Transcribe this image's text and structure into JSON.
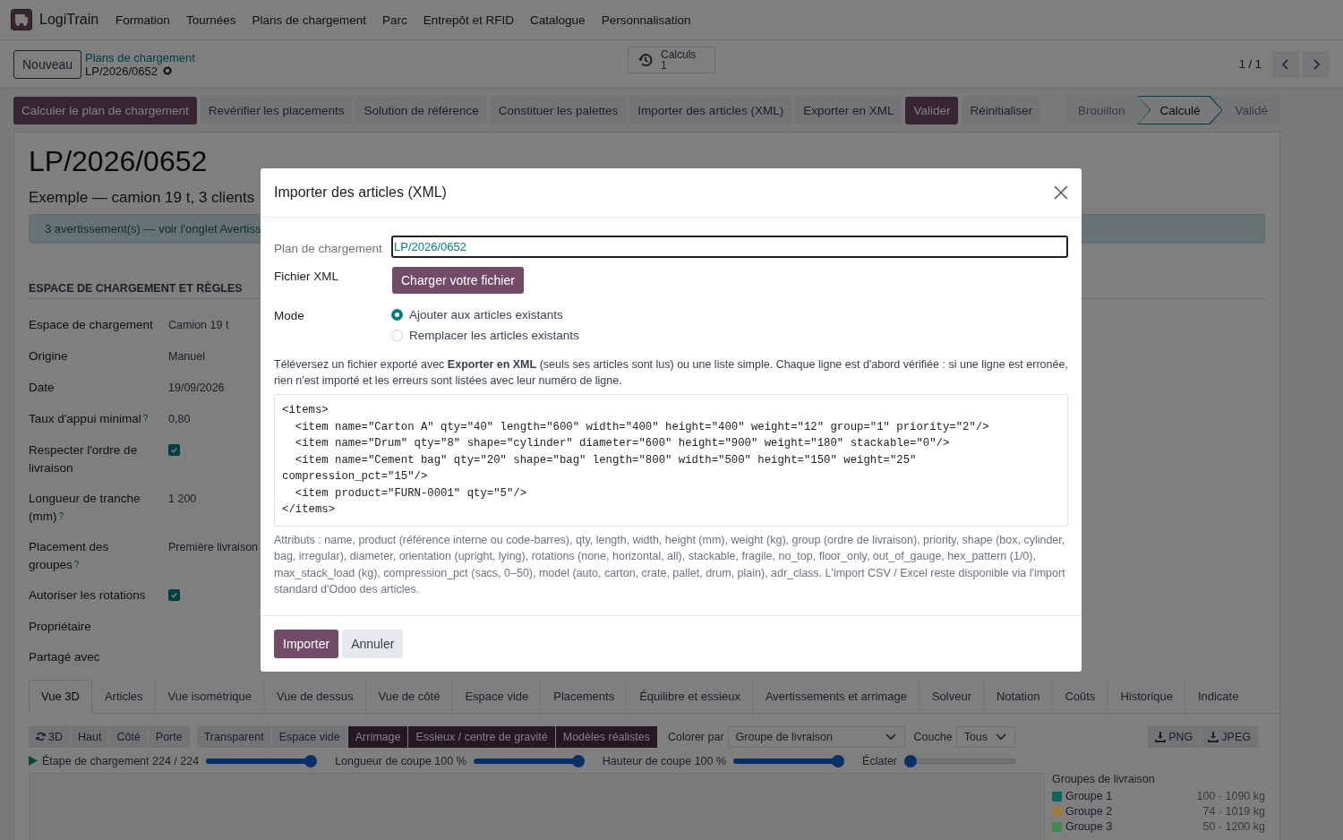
{
  "navbar": {
    "app_name": "LogiTrain",
    "menu": [
      "Formation",
      "Tournées",
      "Plans de chargement",
      "Parc",
      "Entrepôt et RFID",
      "Catalogue",
      "Personnalisation"
    ]
  },
  "control_panel": {
    "new_button": "Nouveau",
    "breadcrumb": "Plans de chargement",
    "record": "LP/2026/0652",
    "stat_button": {
      "label": "Calculs",
      "value": "1"
    },
    "pager": "1 / 1"
  },
  "action_buttons": [
    {
      "label": "Calculer le plan de chargement",
      "primary": true
    },
    {
      "label": "Revérifier les placements",
      "primary": false
    },
    {
      "label": "Solution de référence",
      "primary": false
    },
    {
      "label": "Constituer les palettes",
      "primary": false
    },
    {
      "label": "Importer des articles (XML)",
      "primary": false
    },
    {
      "label": "Exporter en XML",
      "primary": false
    },
    {
      "label": "Valider",
      "primary": true
    },
    {
      "label": "Réinitialiser",
      "primary": false
    }
  ],
  "status_steps": [
    {
      "label": "Brouillon",
      "selected": false
    },
    {
      "label": "Calculé",
      "selected": true
    },
    {
      "label": "Validé",
      "selected": false
    }
  ],
  "sheet": {
    "title": "LP/2026/0652",
    "subtitle": "Exemple — camion 19 t, 3 clients",
    "alert": "3 avertissement(s) — voir l'onglet Avertiss",
    "section": "ESPACE DE CHARGEMENT ET RÈGLES",
    "fields": [
      {
        "label": "Espace de chargement",
        "kind": "text",
        "value": "Camion 19 t"
      },
      {
        "label": "Origine",
        "kind": "text",
        "value": "Manuel"
      },
      {
        "label": "Date",
        "kind": "text",
        "value": "19/09/2026"
      },
      {
        "label": "Taux d'appui minimal",
        "help": "?",
        "kind": "text",
        "value": "0,80"
      },
      {
        "label": "Respecter l'ordre de livraison",
        "kind": "checkbox",
        "checked": true
      },
      {
        "label": "Longueur de tranche (mm)",
        "help": "?",
        "kind": "text",
        "value": "1 200"
      },
      {
        "label": "Placement des groupes",
        "help": "?",
        "kind": "text",
        "value": "Première livraison"
      },
      {
        "label": "Autoriser les rotations",
        "kind": "checkbox",
        "checked": true
      },
      {
        "label": "Propriétaire",
        "kind": "empty"
      },
      {
        "label": "Partagé avec",
        "kind": "empty"
      }
    ]
  },
  "notebook": {
    "tabs": [
      {
        "label": "Vue 3D",
        "selected": true
      },
      {
        "label": "Articles",
        "selected": false
      },
      {
        "label": "Vue isométrique",
        "selected": false
      },
      {
        "label": "Vue de dessus",
        "selected": false
      },
      {
        "label": "Vue de côté",
        "selected": false
      },
      {
        "label": "Espace vide",
        "selected": false
      },
      {
        "label": "Placements",
        "selected": false
      },
      {
        "label": "Équilibre et essieux",
        "selected": false
      },
      {
        "label": "Avertissements et arrimage",
        "selected": false
      },
      {
        "label": "Solveur",
        "selected": false
      },
      {
        "label": "Notation",
        "selected": false
      },
      {
        "label": "Coûts",
        "selected": false
      },
      {
        "label": "Historique",
        "selected": false
      },
      {
        "label": "Indicate",
        "selected": false
      }
    ]
  },
  "viewer": {
    "view_buttons": [
      "3D",
      "Haut",
      "Côté",
      "Porte"
    ],
    "toggles": [
      {
        "label": "Transparent",
        "on": false
      },
      {
        "label": "Espace vide",
        "on": false
      },
      {
        "label": "Arrimage",
        "on": true
      },
      {
        "label": "Essieux / centre de gravité",
        "on": true
      },
      {
        "label": "Modèles réalistes",
        "on": true
      }
    ],
    "color_by": {
      "label": "Colorer par",
      "value": "Groupe de livraison"
    },
    "layer": {
      "label": "Couche",
      "value": "Tous"
    },
    "exports": [
      "PNG",
      "JPEG"
    ],
    "sliders": [
      {
        "label": "Étape de chargement 224 / 224",
        "level": 1
      },
      {
        "label": "Longueur de coupe 100 %",
        "level": 1
      },
      {
        "label": "Hauteur de coupe 100 %",
        "level": 1
      },
      {
        "label": "Éclater",
        "level": 0
      }
    ],
    "legend": {
      "title": "Groupes de livraison",
      "items": [
        {
          "name": "Groupe 1",
          "stats": "100 · 1090 kg",
          "color": "#0e6560"
        },
        {
          "name": "Groupe 2",
          "stats": "74 · 1019 kg",
          "color": "#9e7a3c"
        },
        {
          "name": "Groupe 3",
          "stats": "50 · 1200 kg",
          "color": "#3f8a4a"
        }
      ]
    }
  },
  "modal": {
    "title": "Importer des articles (XML)",
    "plan": {
      "label": "Plan de chargement",
      "value": "LP/2026/0652"
    },
    "file": {
      "label": "Fichier XML",
      "button": "Charger votre fichier"
    },
    "mode": {
      "label": "Mode",
      "options": [
        {
          "label": "Ajouter aux articles existants",
          "selected": true
        },
        {
          "label": "Remplacer les articles existants",
          "selected": false
        }
      ]
    },
    "help": "Téléversez un fichier exporté avec **Exporter en XML** (seuls ses articles sont lus) ou une liste simple. Chaque ligne est d'abord vérifiée : si une ligne est erronée, rien n'est importé et les erreurs sont listées avec leur numéro de ligne.",
    "code": "<items>\n  <item name=\"Carton A\" qty=\"40\" length=\"600\" width=\"400\" height=\"400\" weight=\"12\" group=\"1\" priority=\"2\"/>\n  <item name=\"Drum\" qty=\"8\" shape=\"cylinder\" diameter=\"600\" height=\"900\" weight=\"180\" stackable=\"0\"/>\n  <item name=\"Cement bag\" qty=\"20\" shape=\"bag\" length=\"800\" width=\"500\" height=\"150\" weight=\"25\" compression_pct=\"15\"/>\n  <item product=\"FURN-0001\" qty=\"5\"/>\n</items>",
    "note": "Attributs : name, product (référence interne ou code-barres), qty, length, width, height (mm), weight (kg), group (ordre de livraison), priority, shape (box, cylinder, bag, irregular), diameter, orientation (upright, lying), rotations (none, horizontal, all), stackable, fragile, no_top, floor_only, out_of_gauge, hex_pattern (1/0), max_stack_load (kg), compression_pct (sacs, 0–50), model (auto, carton, crate, pallet, drum, plain), adr_class. L'import CSV / Excel reste disponible via l'import standard d'Odoo des articles.",
    "buttons": [
      {
        "label": "Importer",
        "primary": true
      },
      {
        "label": "Annuler",
        "primary": false
      }
    ]
  }
}
